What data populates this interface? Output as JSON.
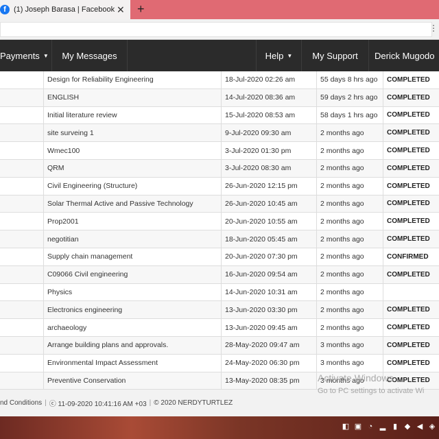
{
  "browser": {
    "tab_title": "(1) Joseph Barasa | Facebook",
    "tab_icon": "f",
    "close_glyph": "✕",
    "new_tab_glyph": "+",
    "menu_glyph": "⋮"
  },
  "nav": {
    "payments": "Payments",
    "messages": "My Messages",
    "help": "Help",
    "support": "My Support",
    "user": "Derick Mugodo",
    "caret": "▼"
  },
  "rows": [
    {
      "title": "Design for Reliability Engineering",
      "date": "18-Jul-2020 02:26 am",
      "ago": "55 days 8 hrs ago",
      "status": "COMPLETED"
    },
    {
      "title": "ENGLISH",
      "date": "14-Jul-2020 08:36 am",
      "ago": "59 days 2 hrs ago",
      "status": "COMPLETED"
    },
    {
      "title": "Initial literature review",
      "date": "15-Jul-2020 08:53 am",
      "ago": "58 days 1 hrs ago",
      "status": "COMPLETED"
    },
    {
      "title": "site surveing 1",
      "date": "9-Jul-2020 09:30 am",
      "ago": "2 months ago",
      "status": "COMPLETED"
    },
    {
      "title": "Wmec100",
      "date": "3-Jul-2020 01:30 pm",
      "ago": "2 months ago",
      "status": "COMPLETED"
    },
    {
      "title": "QRM",
      "date": "3-Jul-2020 08:30 am",
      "ago": "2 months ago",
      "status": "COMPLETED"
    },
    {
      "title": "Civil Engineering (Structure)",
      "date": "26-Jun-2020 12:15 pm",
      "ago": "2 months ago",
      "status": "COMPLETED"
    },
    {
      "title": "Solar Thermal Active and Passive Technology",
      "date": "26-Jun-2020 10:45 am",
      "ago": "2 months ago",
      "status": "COMPLETED"
    },
    {
      "title": "Prop2001",
      "date": "20-Jun-2020 10:55 am",
      "ago": "2 months ago",
      "status": "COMPLETED"
    },
    {
      "title": "negotitian",
      "date": "18-Jun-2020 05:45 am",
      "ago": "2 months ago",
      "status": "COMPLETED"
    },
    {
      "title": "Supply chain management",
      "date": "20-Jun-2020 07:30 pm",
      "ago": "2 months ago",
      "status": "CONFIRMED"
    },
    {
      "title": "C09066 Civil engineering",
      "date": "16-Jun-2020 09:54 am",
      "ago": "2 months ago",
      "status": "COMPLETED"
    },
    {
      "title": "Physics",
      "date": "14-Jun-2020 10:31 am",
      "ago": "2 months ago",
      "status": ""
    },
    {
      "title": "Electronics engineering",
      "date": "13-Jun-2020 03:30 pm",
      "ago": "2 months ago",
      "status": "COMPLETED"
    },
    {
      "title": "archaeology",
      "date": "13-Jun-2020 09:45 am",
      "ago": "2 months ago",
      "status": "COMPLETED"
    },
    {
      "title": "Arrange building plans and approvals.",
      "date": "28-May-2020 09:47 am",
      "ago": "3 months ago",
      "status": "COMPLETED"
    },
    {
      "title": "Environmental Impact Assessment",
      "date": "24-May-2020 06:30 pm",
      "ago": "3 months ago",
      "status": "COMPLETED"
    },
    {
      "title": "Preventive Conservation",
      "date": "13-May-2020 08:35 pm",
      "ago": "3 months ago",
      "status": "COMPLETED"
    }
  ],
  "footer": {
    "terms": "nd Conditions",
    "separator": "|",
    "timestamp": "ⓒ 11-09-2020 10:41:16 AM +03",
    "copyright": "© 2020 NERDYTURTLEZ"
  },
  "watermark": {
    "title": "Activate Windows",
    "subtitle": "Go to PC settings to activate Wi"
  }
}
